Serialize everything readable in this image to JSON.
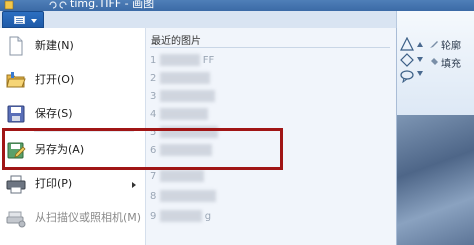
{
  "window": {
    "title": "timg.TIFF - 画图"
  },
  "menu": {
    "items": [
      {
        "label": "新建(N)",
        "icon": "new-document-icon",
        "enabled": true,
        "submenu": false
      },
      {
        "label": "打开(O)",
        "icon": "open-folder-icon",
        "enabled": true,
        "submenu": false
      },
      {
        "label": "保存(S)",
        "icon": "save-disk-icon",
        "enabled": true,
        "submenu": false
      },
      {
        "label": "另存为(A)",
        "icon": "save-as-icon",
        "enabled": true,
        "submenu": false,
        "highlighted": true
      },
      {
        "label": "打印(P)",
        "icon": "printer-icon",
        "enabled": true,
        "submenu": true
      },
      {
        "label": "从扫描仪或照相机(M)",
        "icon": "scanner-icon",
        "enabled": false,
        "submenu": false
      }
    ],
    "recent": {
      "header": "最近的图片",
      "items": [
        "1",
        "2",
        "3",
        "4",
        "5",
        "6",
        "7",
        "8",
        "9"
      ],
      "visible_suffixes": [
        "FF",
        "",
        "",
        "",
        "",
        "",
        "",
        "",
        "g"
      ]
    }
  },
  "ribbon": {
    "outline": "轮廓",
    "fill": "填充"
  },
  "colors": {
    "title_bar": "#3b6aa6",
    "highlight_border": "#a01515",
    "menu_bg": "#ffffff",
    "recent_bg": "#f1f5fb"
  }
}
